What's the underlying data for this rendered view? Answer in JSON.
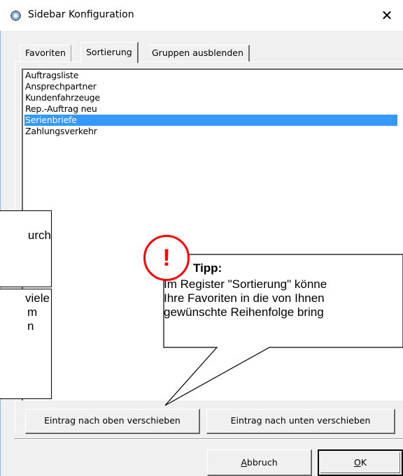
{
  "window": {
    "title": "Sidebar Konfiguration",
    "close_glyph": "✕",
    "icon": "gear-icon"
  },
  "tabs": [
    {
      "label": "Favoriten",
      "active": false
    },
    {
      "label": "Sortierung",
      "active": true
    },
    {
      "label": "Gruppen ausblenden",
      "active": false
    }
  ],
  "list": {
    "items": [
      {
        "label": "Auftragsliste",
        "selected": false
      },
      {
        "label": "Ansprechpartner",
        "selected": false
      },
      {
        "label": "Kundenfahrzeuge",
        "selected": false
      },
      {
        "label": "Rep.-Auftrag neu",
        "selected": false
      },
      {
        "label": "Serienbriefe",
        "selected": true
      },
      {
        "label": "Zahlungsverkehr",
        "selected": false
      }
    ],
    "selection_color": "#3399ff"
  },
  "buttons": {
    "move_up": "Eintrag nach oben verschieben",
    "move_down": "Eintrag nach unten verschieben",
    "cancel": {
      "underlined": "A",
      "rest": "bbruch"
    },
    "ok": {
      "underlined": "O",
      "rest": "K"
    }
  },
  "callouts": {
    "left_top": "urch",
    "left_bottom": [
      "viele",
      "m",
      "n"
    ]
  },
  "tip": {
    "badge": "!",
    "title": "Tipp:",
    "lines": [
      "Im Register \"Sortierung\" könne",
      "Ihre Favoriten in die von Ihnen",
      "gewünschte Reihenfolge bring"
    ],
    "badge_color": "#ff0000"
  }
}
